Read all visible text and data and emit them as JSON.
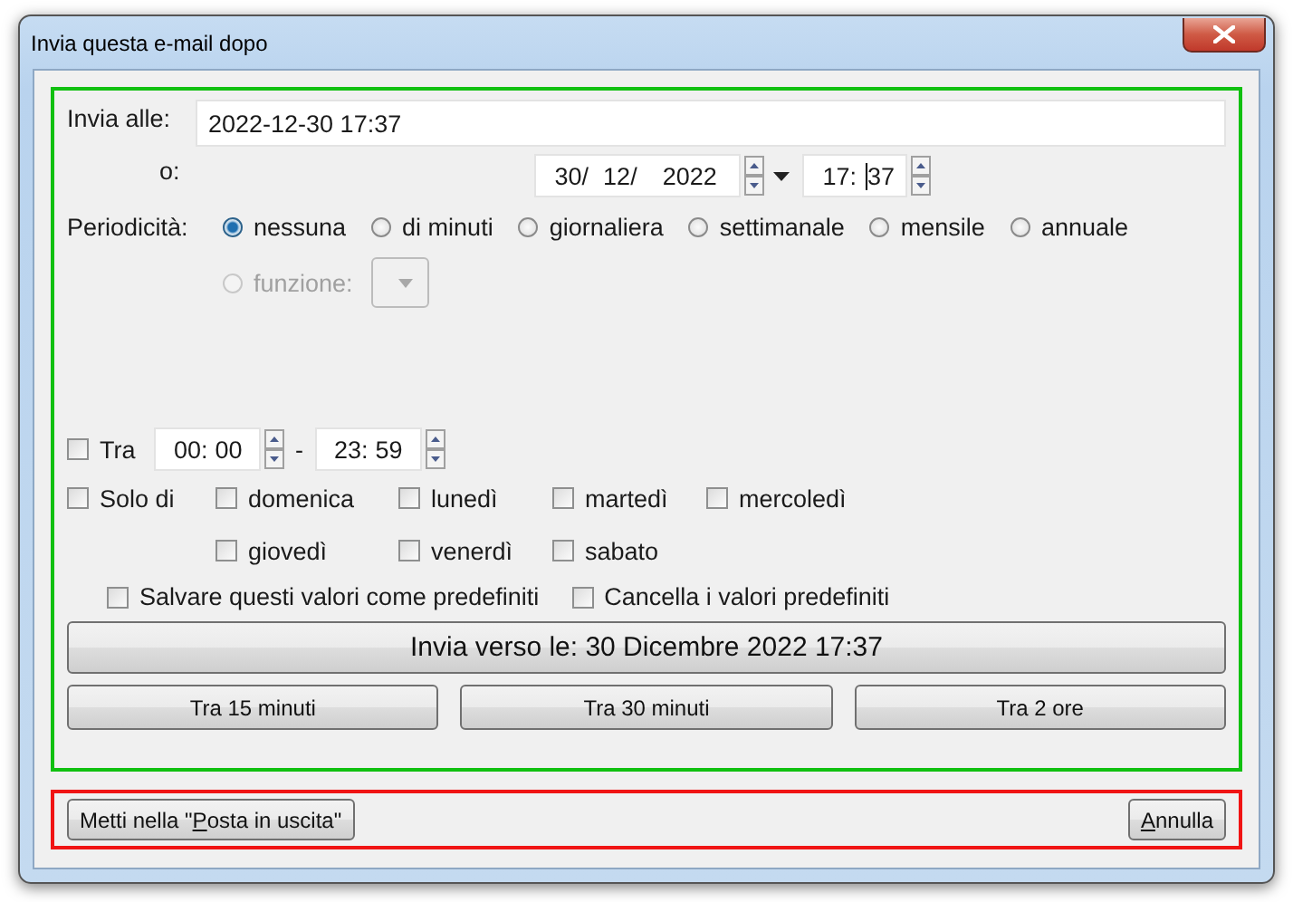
{
  "window": {
    "title": "Invia questa e-mail dopo"
  },
  "send_at": {
    "label": "Invia alle:",
    "value": "2022-12-30 17:37"
  },
  "or": {
    "label": "o:",
    "date": {
      "day": "30/",
      "month": "12/",
      "year": "2022"
    },
    "time": {
      "hour": "17:",
      "minute": "37"
    }
  },
  "recurrence": {
    "label": "Periodicità:",
    "options": [
      {
        "label": "nessuna",
        "selected": true
      },
      {
        "label": "di minuti",
        "selected": false
      },
      {
        "label": "giornaliera",
        "selected": false
      },
      {
        "label": "settimanale",
        "selected": false
      },
      {
        "label": "mensile",
        "selected": false
      },
      {
        "label": "annuale",
        "selected": false
      }
    ],
    "function": {
      "label": "funzione:",
      "selected": false,
      "disabled": true
    }
  },
  "between": {
    "label": "Tra",
    "checked": false,
    "from": {
      "hour": "00:",
      "minute": "00"
    },
    "separator": "-",
    "to": {
      "hour": "23:",
      "minute": "59"
    }
  },
  "only_on": {
    "label": "Solo di",
    "checked": false,
    "days": [
      {
        "label": "domenica",
        "checked": false
      },
      {
        "label": "lunedì",
        "checked": false
      },
      {
        "label": "martedì",
        "checked": false
      },
      {
        "label": "mercoledì",
        "checked": false
      },
      {
        "label": "giovedì",
        "checked": false
      },
      {
        "label": "venerdì",
        "checked": false
      },
      {
        "label": "sabato",
        "checked": false
      }
    ]
  },
  "defaults": [
    {
      "label": "Salvare questi valori come predefiniti",
      "checked": false
    },
    {
      "label": "Cancella i valori predefiniti",
      "checked": false
    }
  ],
  "send_button": "Invia verso le: 30 Dicembre 2022 17:37",
  "quick_buttons": [
    "Tra 15 minuti",
    "Tra 30 minuti",
    "Tra 2 ore"
  ],
  "footer": {
    "outbox_button": {
      "before": "Metti nella \"",
      "key": "P",
      "after": "osta in uscita\""
    },
    "cancel_button": {
      "key": "A",
      "after": "nnulla"
    }
  }
}
